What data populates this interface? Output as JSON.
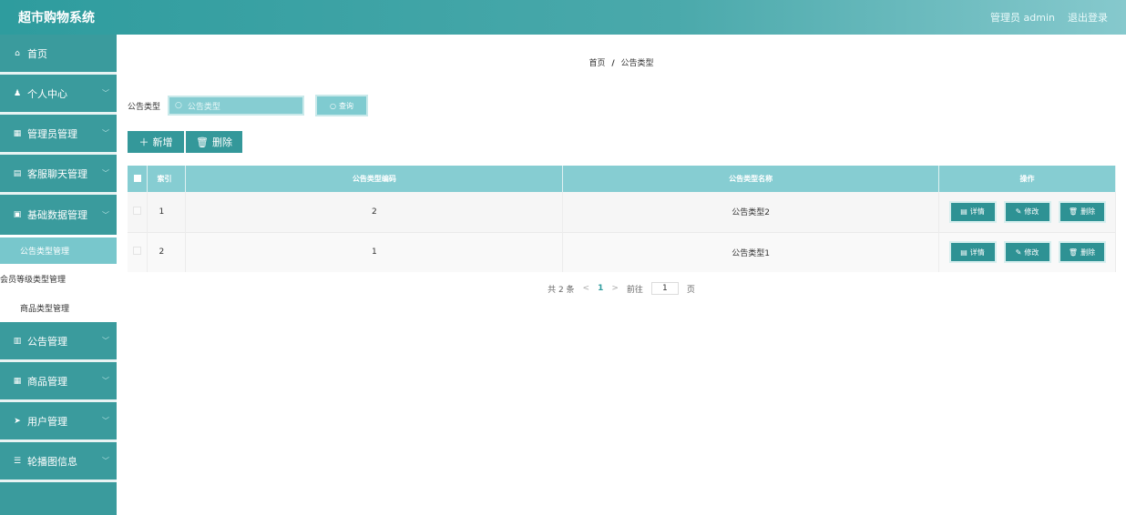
{
  "header": {
    "brand": "超市购物系统",
    "user": "管理员 admin",
    "logout": "退出登录"
  },
  "sidebar": {
    "items": [
      {
        "label": "首页",
        "icon": "home-icon",
        "glyph": "⌂"
      },
      {
        "label": "个人中心",
        "icon": "user-icon",
        "glyph": "♟"
      },
      {
        "label": "管理员管理",
        "icon": "grid-icon",
        "glyph": "▦"
      },
      {
        "label": "客服聊天管理",
        "icon": "clipboard-icon",
        "glyph": "▤"
      },
      {
        "label": "基础数据管理",
        "icon": "table-icon",
        "glyph": "▣"
      }
    ],
    "subitems": [
      {
        "label": "公告类型管理"
      },
      {
        "label": "会员等级类型管理"
      },
      {
        "label": "商品类型管理"
      }
    ],
    "items2": [
      {
        "label": "公告管理",
        "icon": "chart-icon",
        "glyph": "▥"
      },
      {
        "label": "商品管理",
        "icon": "grid-icon",
        "glyph": "▦"
      },
      {
        "label": "用户管理",
        "icon": "send-icon",
        "glyph": "➤"
      },
      {
        "label": "轮播图信息",
        "icon": "sliders-icon",
        "glyph": "☰"
      }
    ]
  },
  "breadcrumb": {
    "home": "首页",
    "sep": "/",
    "current": "公告类型"
  },
  "search": {
    "label": "公告类型",
    "placeholder": "公告类型",
    "button": "查询"
  },
  "toolbar": {
    "add": "新增",
    "delete": "删除"
  },
  "table": {
    "headers": {
      "index": "索引",
      "code": "公告类型编码",
      "name": "公告类型名称",
      "action": "操作"
    },
    "rows": [
      {
        "index": "1",
        "code": "2",
        "name": "公告类型2"
      },
      {
        "index": "2",
        "code": "1",
        "name": "公告类型1"
      }
    ],
    "actions": {
      "detail": "详情",
      "edit": "修改",
      "delete": "删除"
    }
  },
  "pagination": {
    "total": "共 2 条",
    "prev": "<",
    "page": "1",
    "next": ">",
    "goto": "前往",
    "jump_value": "1",
    "unit": "页"
  },
  "colors": {
    "primary": "#2e9c9e",
    "header_cell": "#86cdd2",
    "sidebar": "#3a9b9d"
  }
}
